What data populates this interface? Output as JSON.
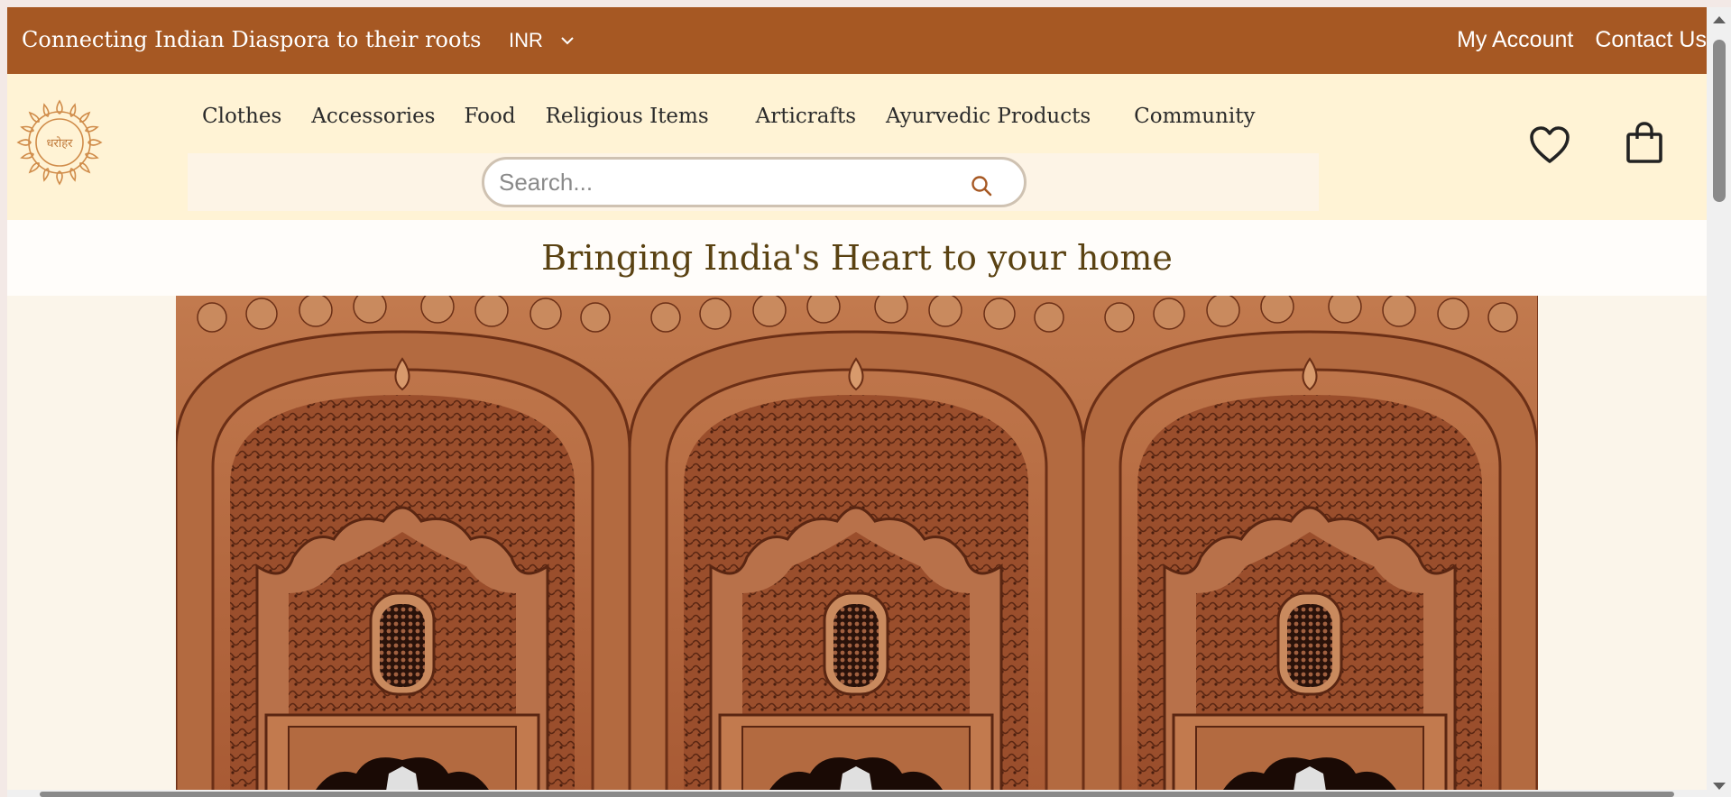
{
  "topbar": {
    "tagline": "Connecting Indian Diaspora to their roots",
    "currency": "INR",
    "links": [
      "My Account",
      "Contact Us"
    ],
    "color": "#a65823"
  },
  "header": {
    "logo_text": "धरोहर",
    "nav": [
      "Clothes",
      "Accessories",
      "Food",
      "Religious Items",
      "Articrafts",
      "Ayurvedic Products",
      "Community"
    ],
    "search_placeholder": "Search...",
    "icons": [
      "heart-icon",
      "shopping-bag-icon",
      "search-icon"
    ],
    "background": "#fff3d5"
  },
  "hero": {
    "title": "Bringing India's Heart to your home",
    "image": "carved sandstone arched windows (repeated three times)"
  }
}
